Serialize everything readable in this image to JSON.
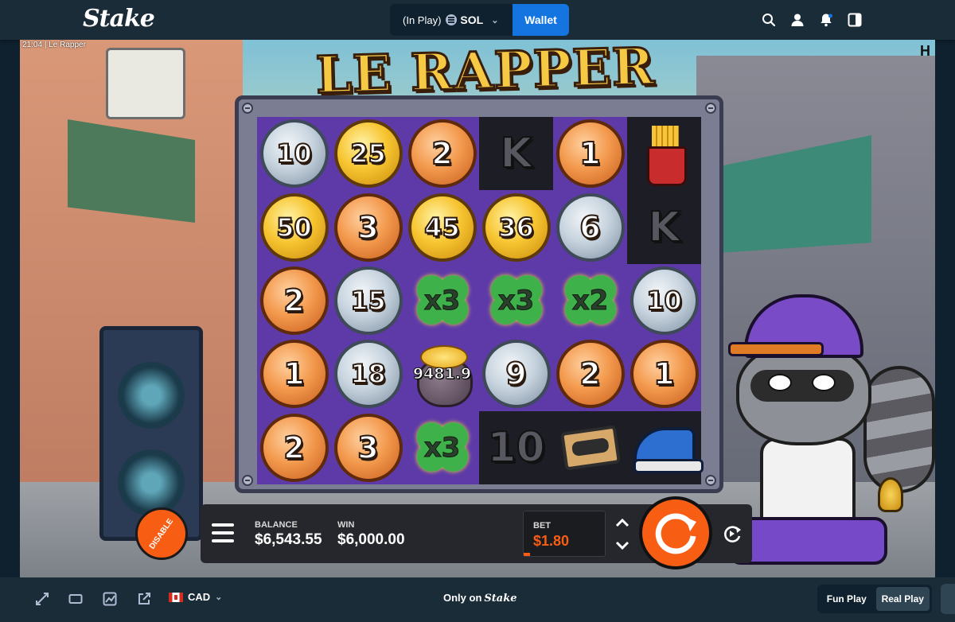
{
  "header": {
    "logo": "Stake",
    "balance_status": "(In Play)",
    "currency": "SOL",
    "wallet_label": "Wallet",
    "icons": [
      "search-icon",
      "user-icon",
      "notification-icon",
      "sidebar-toggle-icon"
    ]
  },
  "game": {
    "clock": "21:04",
    "game_name": "Le Rapper",
    "title": "LE RAPPER",
    "grid": [
      [
        {
          "kind": "coin",
          "tone": "silver",
          "value": "10"
        },
        {
          "kind": "coin",
          "tone": "gold",
          "value": "25"
        },
        {
          "kind": "coin",
          "tone": "bronze",
          "value": "2"
        },
        {
          "kind": "letter",
          "value": "K"
        },
        {
          "kind": "coin",
          "tone": "bronze",
          "value": "1"
        },
        {
          "kind": "fries"
        }
      ],
      [
        {
          "kind": "coin",
          "tone": "gold",
          "value": "50"
        },
        {
          "kind": "coin",
          "tone": "bronze",
          "value": "3"
        },
        {
          "kind": "coin",
          "tone": "gold",
          "value": "45"
        },
        {
          "kind": "coin",
          "tone": "gold",
          "value": "36"
        },
        {
          "kind": "coin",
          "tone": "silver",
          "value": "6"
        },
        {
          "kind": "letter",
          "value": "K"
        }
      ],
      [
        {
          "kind": "coin",
          "tone": "bronze",
          "value": "2"
        },
        {
          "kind": "coin",
          "tone": "silver",
          "value": "15"
        },
        {
          "kind": "clover",
          "value": "x3"
        },
        {
          "kind": "clover",
          "value": "x3"
        },
        {
          "kind": "clover",
          "value": "x2"
        },
        {
          "kind": "coin",
          "tone": "silver",
          "value": "10"
        }
      ],
      [
        {
          "kind": "coin",
          "tone": "bronze",
          "value": "1"
        },
        {
          "kind": "coin",
          "tone": "silver",
          "value": "18"
        },
        {
          "kind": "pot",
          "value": "9481.9"
        },
        {
          "kind": "coin",
          "tone": "silver",
          "value": "9"
        },
        {
          "kind": "coin",
          "tone": "bronze",
          "value": "2"
        },
        {
          "kind": "coin",
          "tone": "bronze",
          "value": "1"
        }
      ],
      [
        {
          "kind": "coin",
          "tone": "bronze",
          "value": "2"
        },
        {
          "kind": "coin",
          "tone": "bronze",
          "value": "3"
        },
        {
          "kind": "clover",
          "value": "x3"
        },
        {
          "kind": "letter",
          "value": "10"
        },
        {
          "kind": "tape"
        },
        {
          "kind": "shoe"
        }
      ]
    ],
    "disable_label": "DISABLE",
    "balance_label": "BALANCE",
    "balance_value": "$6,543.55",
    "win_label": "WIN",
    "win_value": "$6,000.00",
    "bet_label": "BET",
    "bet_value": "$1.80"
  },
  "footer": {
    "currency_code": "CAD",
    "only_on_text": "Only on",
    "only_on_brand": "Stake",
    "fun_play_label": "Fun Play",
    "real_play_label": "Real Play",
    "active_mode": "Real Play",
    "icons": [
      "fullscreen-icon",
      "theatre-mode-icon",
      "stats-icon",
      "popout-icon"
    ]
  },
  "colors": {
    "topbar": "#1a2c38",
    "wallet_button": "#1475e1",
    "accent_orange": "#f85d14"
  }
}
